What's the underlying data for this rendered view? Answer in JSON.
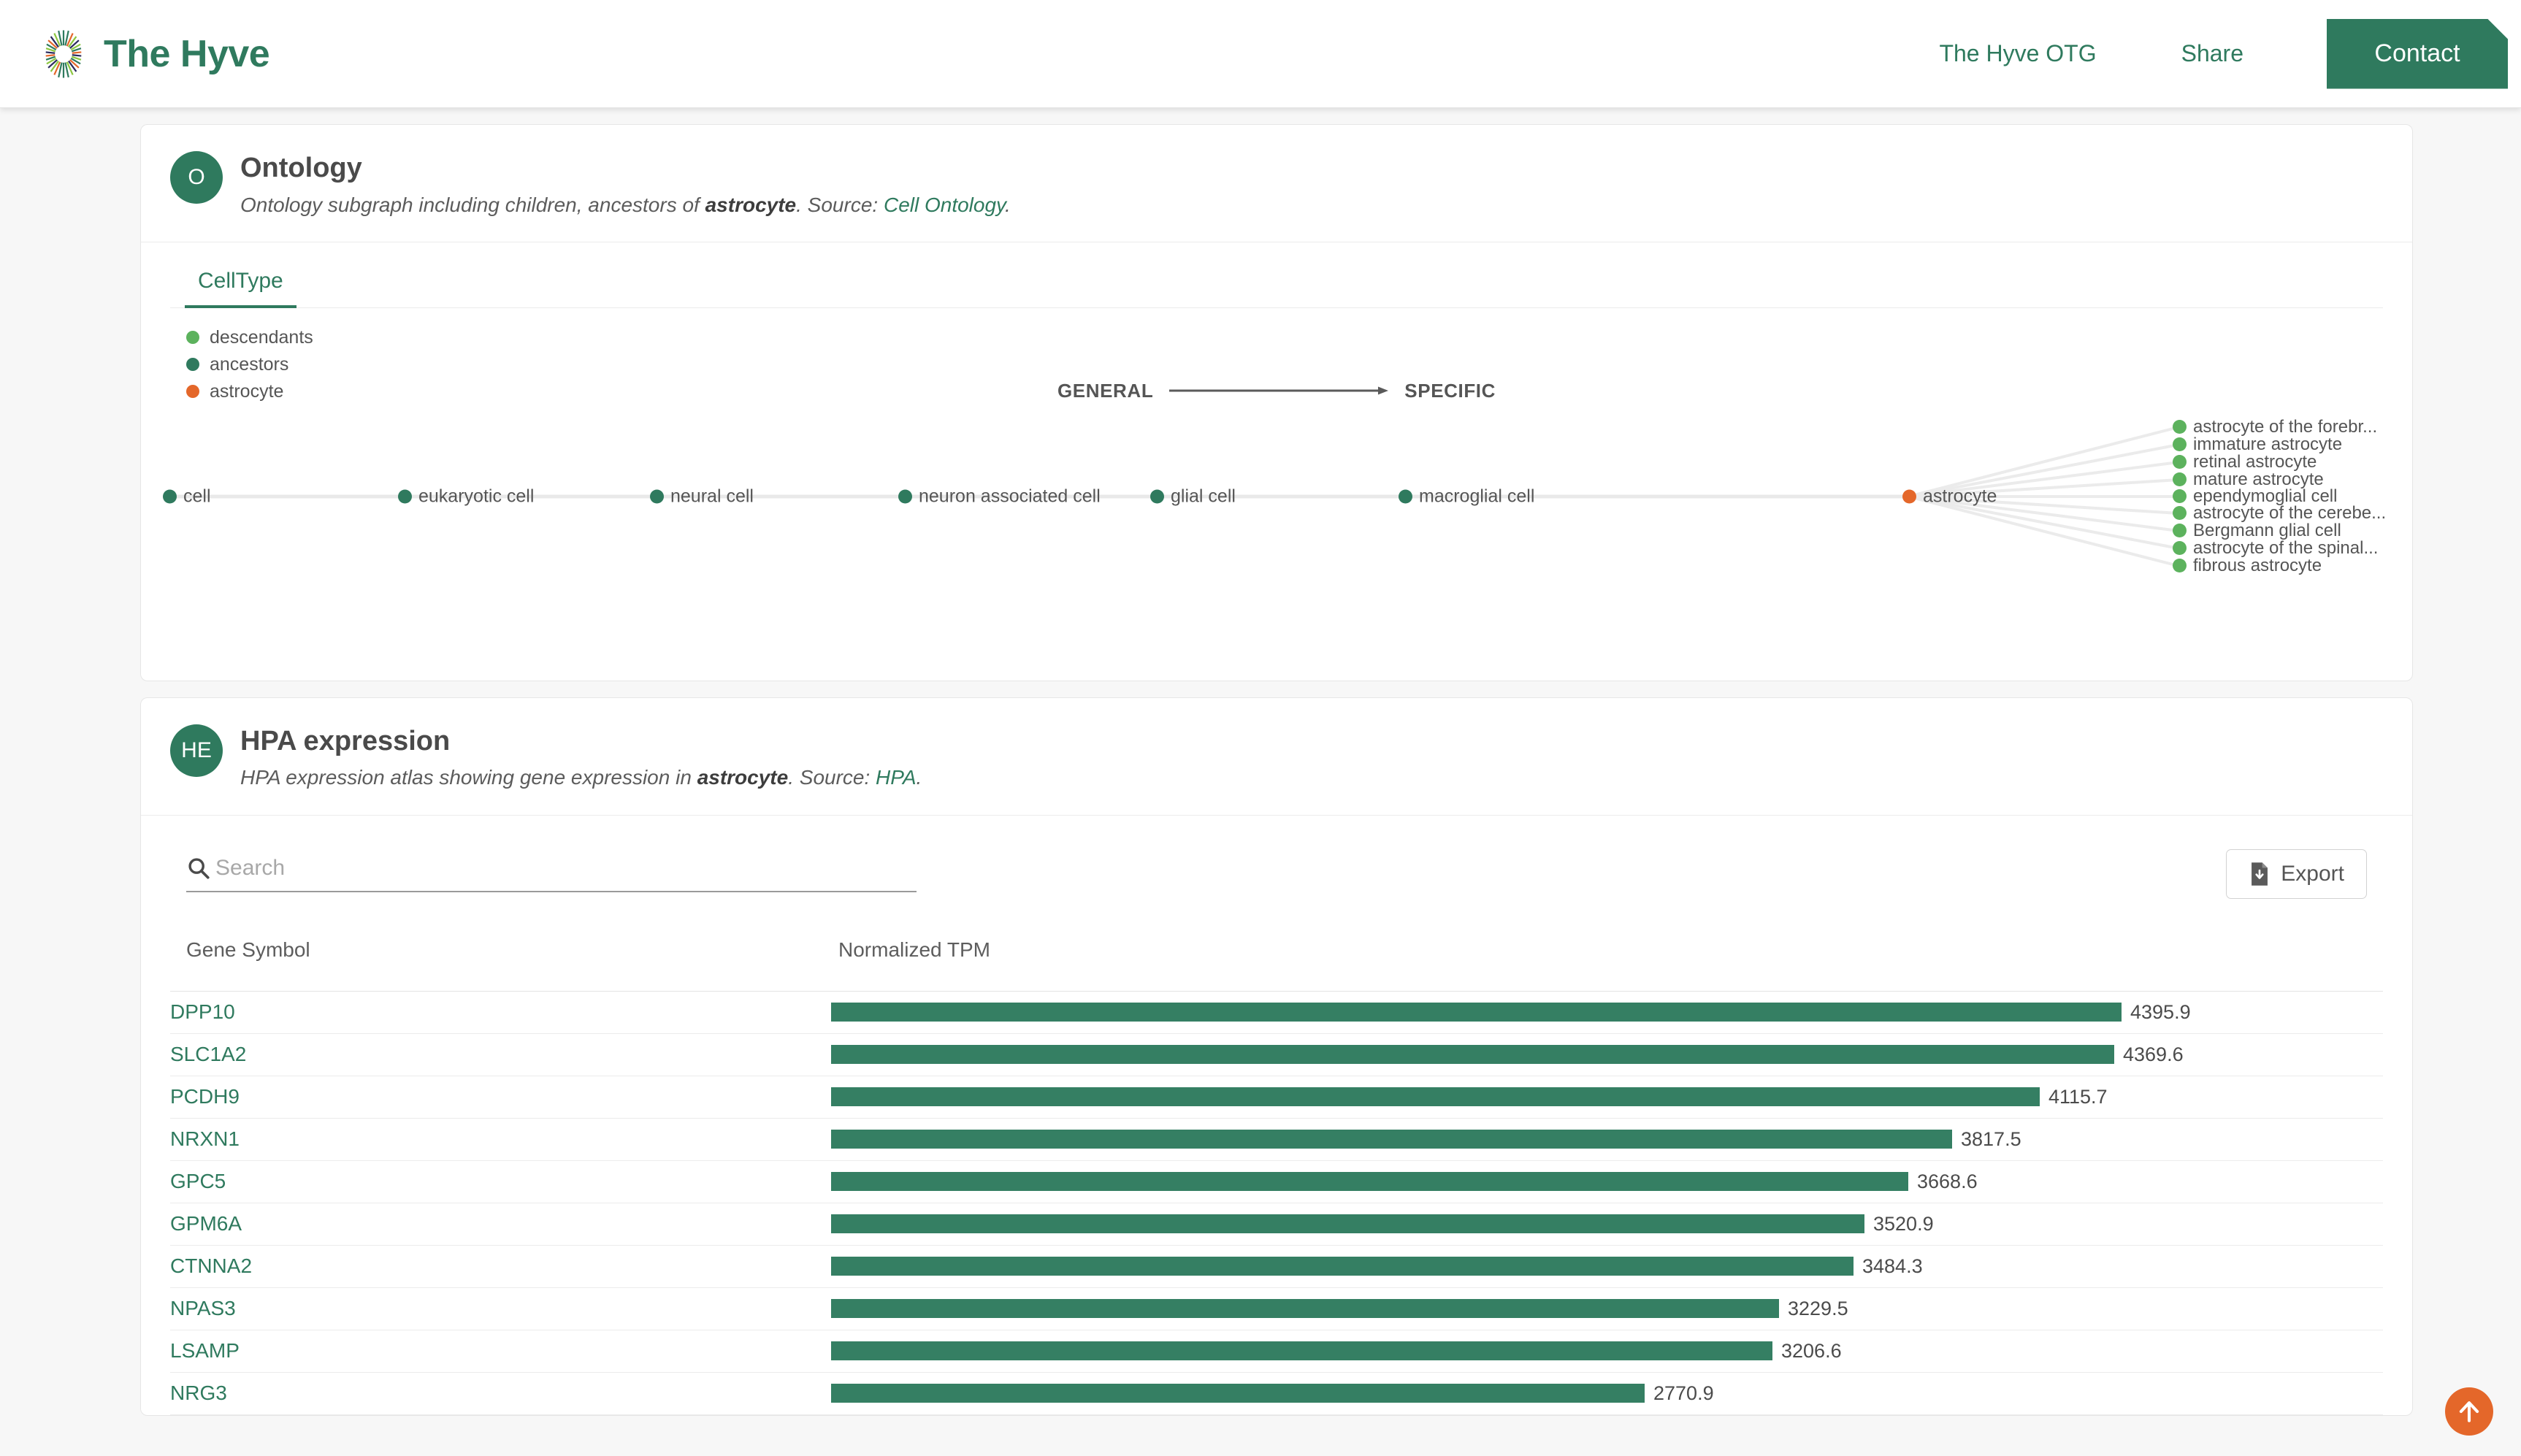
{
  "header": {
    "brand": "The Hyve",
    "brand_mark_icon": "hyve-starburst-logo",
    "nav": [
      {
        "label": "The Hyve OTG"
      },
      {
        "label": "Share"
      }
    ],
    "contact_label": "Contact",
    "accent_green": "#2f7a5e",
    "accent_orange": "#e4672a"
  },
  "ontology": {
    "avatar_initials": "O",
    "title": "Ontology",
    "subtitle_pre": "Ontology subgraph including children, ancestors of ",
    "subtitle_bold": "astrocyte",
    "subtitle_mid": ". Source: ",
    "subtitle_link": "Cell Ontology",
    "subtitle_post": ".",
    "tab_label": "CellType",
    "legend": [
      {
        "label": "descendants",
        "color": "#5cb25d"
      },
      {
        "label": "ancestors",
        "color": "#2f7a5e"
      },
      {
        "label": "astrocyte",
        "color": "#e4672a"
      }
    ],
    "axis_left": "GENERAL",
    "axis_right": "SPECIFIC",
    "ancestors": [
      {
        "label": "cell"
      },
      {
        "label": "eukaryotic cell"
      },
      {
        "label": "neural cell"
      },
      {
        "label": "neuron associated cell"
      },
      {
        "label": "glial cell"
      },
      {
        "label": "macroglial cell"
      }
    ],
    "focus_node": {
      "label": "astrocyte"
    },
    "descendants": [
      {
        "label": "astrocyte of the forebr..."
      },
      {
        "label": "immature astrocyte"
      },
      {
        "label": "retinal astrocyte"
      },
      {
        "label": "mature astrocyte"
      },
      {
        "label": "ependymoglial cell"
      },
      {
        "label": "astrocyte of the cerebe..."
      },
      {
        "label": "Bergmann glial cell"
      },
      {
        "label": "astrocyte of the spinal..."
      },
      {
        "label": "fibrous astrocyte"
      }
    ]
  },
  "hpa": {
    "avatar_initials": "HE",
    "title": "HPA expression",
    "subtitle_pre": "HPA expression atlas showing gene expression in ",
    "subtitle_bold": "astrocyte",
    "subtitle_mid": ". Source: ",
    "subtitle_link": "HPA",
    "subtitle_post": ".",
    "search_placeholder": "Search",
    "search_value": "",
    "search_icon": "search-icon",
    "export_label": "Export",
    "export_icon": "file-download-icon",
    "columns": [
      "Gene Symbol",
      "Normalized TPM"
    ]
  },
  "chart_data": {
    "type": "bar",
    "title": "HPA expression in astrocyte",
    "xlabel": "Normalized TPM",
    "ylabel": "Gene Symbol",
    "orientation": "horizontal",
    "categories": [
      "DPP10",
      "SLC1A2",
      "PCDH9",
      "NRXN1",
      "GPC5",
      "GPM6A",
      "CTNNA2",
      "NPAS3",
      "LSAMP",
      "NRG3"
    ],
    "values": [
      4395.9,
      4369.6,
      4115.7,
      3817.5,
      3668.6,
      3520.9,
      3484.3,
      3229.5,
      3206.6,
      2770.9
    ],
    "value_labels": [
      "4395.9",
      "4369.6",
      "4115.7",
      "3817.5",
      "3668.6",
      "3520.9",
      "3484.3",
      "3229.5",
      "3206.6",
      "2770.9"
    ],
    "bar_color": "#357f63",
    "xlim": [
      0,
      4395.9
    ],
    "grid": false,
    "legend": "none"
  },
  "scroll_top_icon": "arrow-up-icon"
}
